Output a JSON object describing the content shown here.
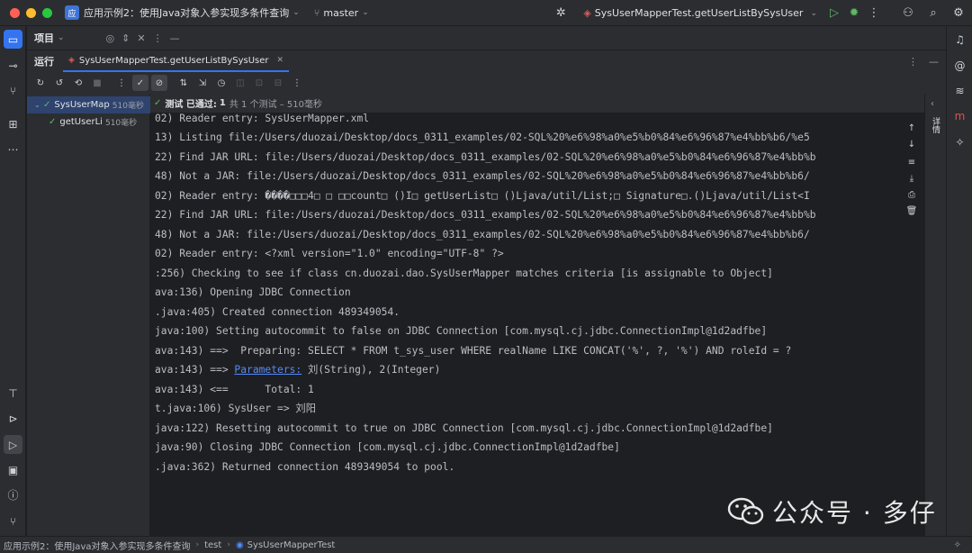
{
  "titlebar": {
    "project_badge": "应",
    "project_name": "应用示例2：使用Java对象入参实现多条件查询",
    "branch": "master",
    "run_config": "SysUserMapperTest.getUserListBySysUser"
  },
  "project_panel": {
    "title": "项目"
  },
  "run_panel": {
    "title": "运行",
    "tab_label": "SysUserMapperTest.getUserListBySysUser"
  },
  "tree": {
    "items": [
      {
        "name": "SysUserMap",
        "time": "510毫秒",
        "selected": true
      },
      {
        "name": "getUserLi",
        "time": "510毫秒",
        "selected": false
      }
    ]
  },
  "status": {
    "prefix": "测试 已通过:",
    "count": "1",
    "detail": "共 1 个测试 – 510毫秒"
  },
  "console": {
    "lines": [
      "02) Reader entry: SysUserMapper.xml",
      "13) Listing file:/Users/duozai/Desktop/docs_0311_examples/02-SQL%20%e6%98%a0%e5%b0%84%e6%96%87%e4%bb%b6/%e5",
      "22) Find JAR URL: file:/Users/duozai/Desktop/docs_0311_examples/02-SQL%20%e6%98%a0%e5%b0%84%e6%96%87%e4%bb%b",
      "48) Not a JAR: file:/Users/duozai/Desktop/docs_0311_examples/02-SQL%20%e6%98%a0%e5%b0%84%e6%96%87%e4%bb%b6/",
      "02) Reader entry: ����□□□4□ □ □□count□ ()I□ getUserList□ ()Ljava/util/List;□ Signature□.()Ljava/util/List<I",
      "22) Find JAR URL: file:/Users/duozai/Desktop/docs_0311_examples/02-SQL%20%e6%98%a0%e5%b0%84%e6%96%87%e4%bb%b",
      "48) Not a JAR: file:/Users/duozai/Desktop/docs_0311_examples/02-SQL%20%e6%98%a0%e5%b0%84%e6%96%87%e4%bb%b6/",
      "02) Reader entry: <?xml version=\"1.0\" encoding=\"UTF-8\" ?>",
      ":256) Checking to see if class cn.duozai.dao.SysUserMapper matches criteria [is assignable to Object]",
      "ava:136) Opening JDBC Connection",
      ".java:405) Created connection 489349054.",
      "java:100) Setting autocommit to false on JDBC Connection [com.mysql.cj.jdbc.ConnectionImpl@1d2adfbe]",
      "ava:143) ==>  Preparing: SELECT * FROM t_sys_user WHERE realName LIKE CONCAT('%', ?, '%') AND roleId = ?",
      "ava:143) <==      Total: 1",
      "t.java:106) SysUser => 刘阳",
      "java:122) Resetting autocommit to true on JDBC Connection [com.mysql.cj.jdbc.ConnectionImpl@1d2adfbe]",
      "java:90) Closing JDBC Connection [com.mysql.cj.jdbc.ConnectionImpl@1d2adfbe]",
      ".java:362) Returned connection 489349054 to pool."
    ],
    "param_prefix": "ava:143) ==> ",
    "param_link": "Parameters:",
    "param_rest": " 刘(String), 2(Integer)"
  },
  "side_panel": {
    "label": "详情"
  },
  "statusbar": {
    "crumbs": [
      "应用示例2：使用Java对象入参实现多条件查询",
      "test",
      "SysUserMapperTest"
    ]
  },
  "watermark": {
    "text": "公众号 · 多仔"
  }
}
